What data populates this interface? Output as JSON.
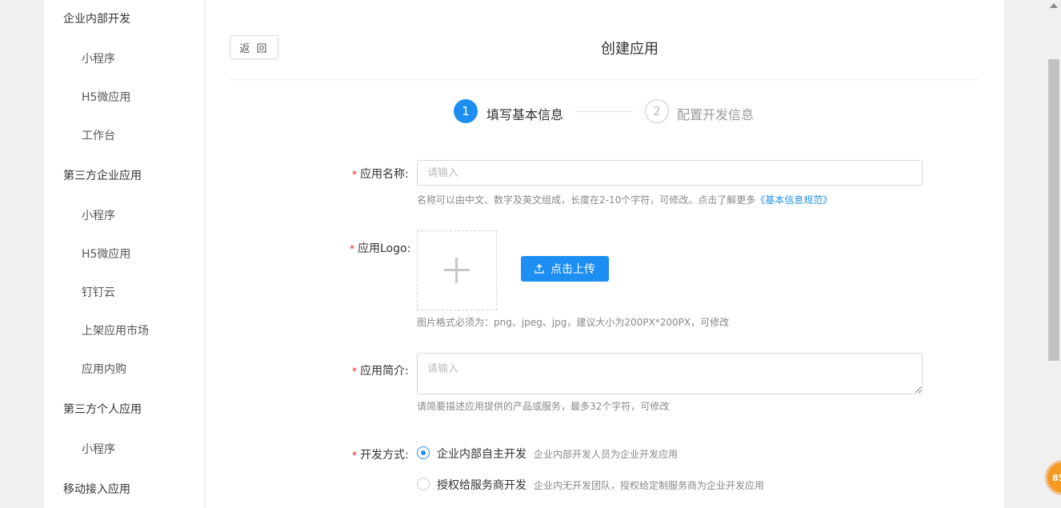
{
  "sidebar": {
    "groups": [
      {
        "label": "企业内部开发",
        "items": [
          "小程序",
          "H5微应用",
          "工作台"
        ]
      },
      {
        "label": "第三方企业应用",
        "items": [
          "小程序",
          "H5微应用",
          "钉钉云",
          "上架应用市场",
          "应用内购"
        ]
      },
      {
        "label": "第三方个人应用",
        "items": [
          "小程序"
        ]
      },
      {
        "label": "移动接入应用",
        "items": []
      }
    ]
  },
  "header": {
    "back_label": "返 回",
    "title": "创建应用"
  },
  "steps": [
    {
      "number": "1",
      "label": "填写基本信息",
      "state": "active"
    },
    {
      "number": "2",
      "label": "配置开发信息",
      "state": "pending"
    }
  ],
  "form": {
    "required_mark": "*",
    "name": {
      "label": "应用名称:",
      "placeholder": "请输入",
      "value": "",
      "hint": "名称可以由中文、数字及英文组成，长度在2-10个字符，可修改。点击了解更多",
      "hint_link": "《基本信息规范》"
    },
    "logo": {
      "label": "应用Logo:",
      "upload_button": "点击上传",
      "hint": "图片格式必须为：png、jpeg、jpg，建议大小为200PX*200PX，可修改"
    },
    "intro": {
      "label": "应用简介:",
      "placeholder": "请输入",
      "value": "",
      "hint": "请简要描述应用提供的产品或服务，最多32个字符，可修改"
    },
    "dev_mode": {
      "label": "开发方式:",
      "options": [
        {
          "label": "企业内部自主开发",
          "desc": "企业内部开发人员为企业开发应用",
          "selected": true
        },
        {
          "label": "授权给服务商开发",
          "desc": "企业内无开发团队，授权给定制服务商为企业开发应用",
          "selected": false
        }
      ]
    }
  },
  "floating_badge": "85",
  "colors": {
    "accent": "#1e8ff2",
    "required": "#e02020",
    "badge": "#f59a23"
  }
}
